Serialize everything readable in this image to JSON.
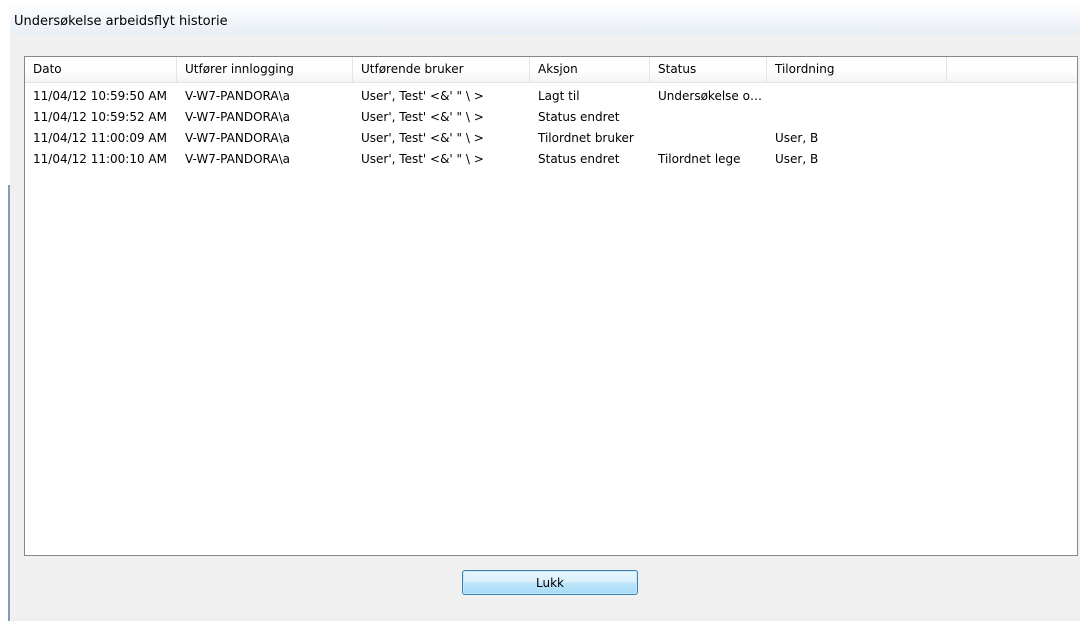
{
  "window": {
    "title": "Undersøkelse arbeidsflyt historie"
  },
  "table": {
    "columns": [
      "Dato",
      "Utfører innlogging",
      "Utførende bruker",
      "Aksjon",
      "Status",
      "Tilordning",
      ""
    ],
    "rows": [
      [
        "11/04/12 10:59:50 AM",
        "V-W7-PANDORA\\a",
        "User', Test' <&' \" \\ >",
        "Lagt til",
        "Undersøkelse o…",
        "",
        ""
      ],
      [
        "11/04/12 10:59:52 AM",
        "V-W7-PANDORA\\a",
        "User', Test' <&' \" \\ >",
        "Status endret",
        "",
        "",
        ""
      ],
      [
        "11/04/12 11:00:09 AM",
        "V-W7-PANDORA\\a",
        "User', Test' <&' \" \\ >",
        "Tilordnet bruker",
        "",
        "User, B",
        ""
      ],
      [
        "11/04/12 11:00:10 AM",
        "V-W7-PANDORA\\a",
        "User', Test' <&' \" \\ >",
        "Status endret",
        "Tilordnet lege",
        "User, B",
        ""
      ]
    ]
  },
  "buttons": {
    "close_label": "Lukk"
  },
  "colors": {
    "window_background": "#f0f0f0",
    "list_background": "#ffffff",
    "list_border": "#828790",
    "button_border": "#3c7fb1",
    "button_fill": "#bee6fd"
  }
}
